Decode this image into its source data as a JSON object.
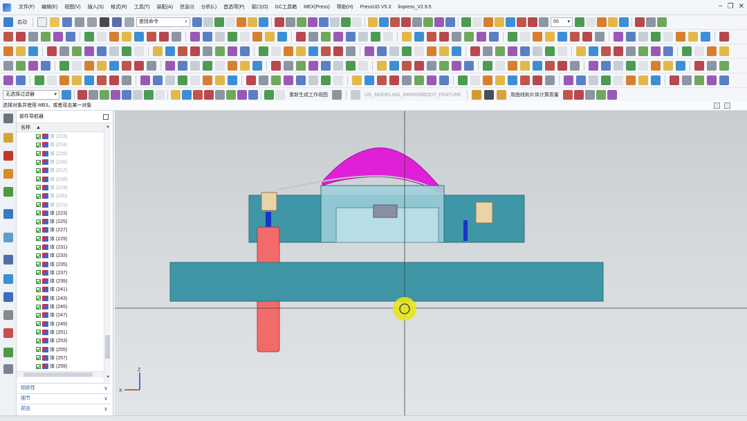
{
  "menu": {
    "items": [
      "文件(F)",
      "编辑(E)",
      "视图(V)",
      "插入(S)",
      "格式(R)",
      "工具(T)",
      "装配(A)",
      "信息(I)",
      "分析(L)",
      "首选项(P)",
      "窗口(O)",
      "GC工具箱",
      "MEX(Press)",
      "帮助(H)",
      "PressUG V5.3",
      "linpress_V2.9.5"
    ]
  },
  "toolbar": {
    "start_label": "启动",
    "find_command_placeholder": "查找命令",
    "zoom_value": "50",
    "filter_value": "无选择过滤器",
    "regen_label": "重新生成工作视图",
    "mirror_feature_label": "UG_MODELING_MIRRORBODY_FEATURE",
    "volume_label": "用曲线和片体计算质量"
  },
  "prompt": {
    "text": "选择对象并使用 MB3，或者双击某一对象"
  },
  "navigator": {
    "title": "部件导航器",
    "column": "名称",
    "rows": [
      {
        "label": "体 (213)",
        "dim": true
      },
      {
        "label": "体 (214)",
        "dim": true
      },
      {
        "label": "体 (215)",
        "dim": true
      },
      {
        "label": "体 (216)",
        "dim": true
      },
      {
        "label": "体 (217)",
        "dim": true
      },
      {
        "label": "体 (218)",
        "dim": true
      },
      {
        "label": "体 (219)",
        "dim": true
      },
      {
        "label": "体 (220)",
        "dim": true
      },
      {
        "label": "体 (221)",
        "dim": true
      },
      {
        "label": "体 (223)",
        "dim": false
      },
      {
        "label": "体 (225)",
        "dim": false
      },
      {
        "label": "体 (227)",
        "dim": false
      },
      {
        "label": "体 (229)",
        "dim": false
      },
      {
        "label": "体 (231)",
        "dim": false
      },
      {
        "label": "体 (233)",
        "dim": false
      },
      {
        "label": "体 (235)",
        "dim": false
      },
      {
        "label": "体 (237)",
        "dim": false
      },
      {
        "label": "体 (239)",
        "dim": false
      },
      {
        "label": "体 (241)",
        "dim": false
      },
      {
        "label": "体 (243)",
        "dim": false
      },
      {
        "label": "体 (245)",
        "dim": false
      },
      {
        "label": "体 (247)",
        "dim": false
      },
      {
        "label": "体 (249)",
        "dim": false
      },
      {
        "label": "体 (251)",
        "dim": false
      },
      {
        "label": "体 (253)",
        "dim": false
      },
      {
        "label": "体 (255)",
        "dim": false
      },
      {
        "label": "体 (257)",
        "dim": false
      },
      {
        "label": "体 (259)",
        "dim": false
      }
    ],
    "panels": [
      "相依性",
      "细节",
      "预览"
    ]
  },
  "viewport": {
    "triad_labels": {
      "x": "X",
      "z": "Z"
    }
  },
  "colors": {
    "plate": "#3e96a6",
    "die_face": "#e020d8",
    "spring": "#f26b6b",
    "highlight": "#e8e61a"
  }
}
